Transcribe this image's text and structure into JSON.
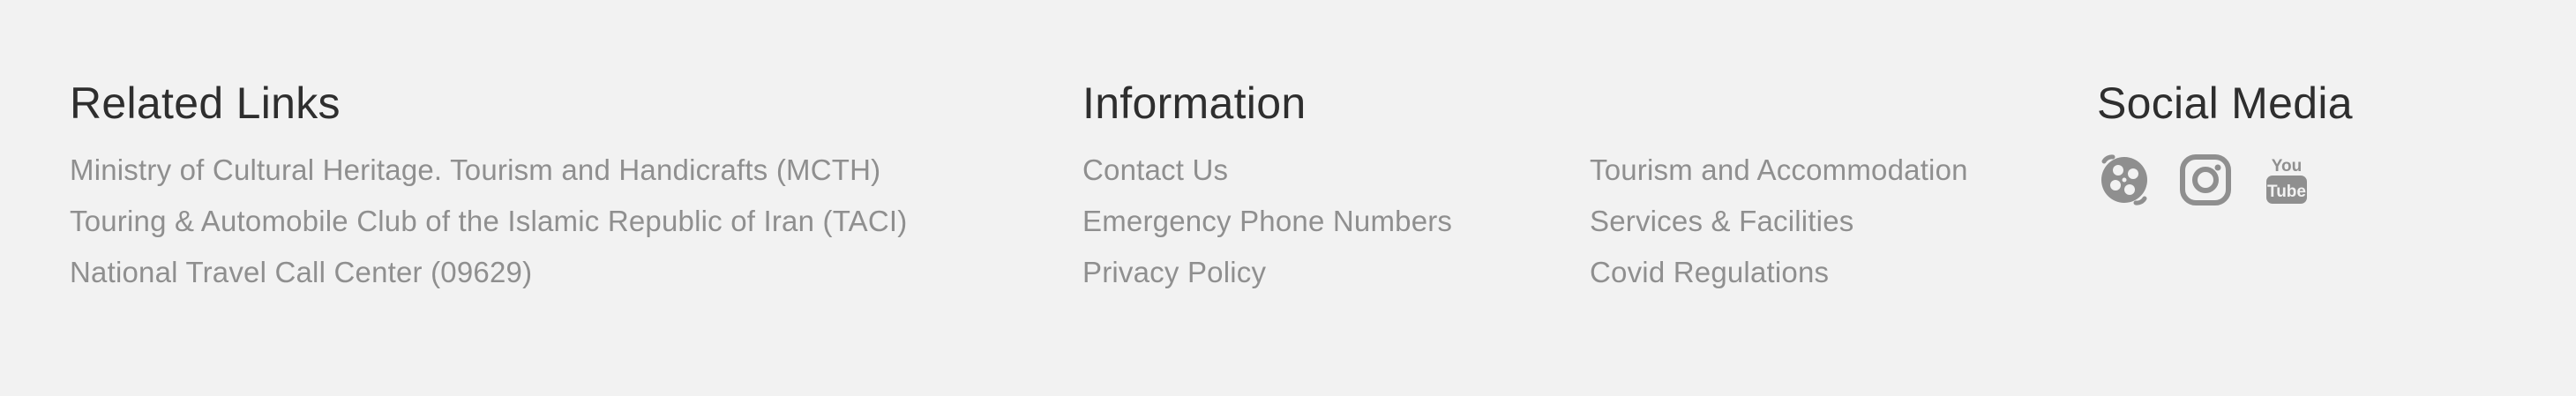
{
  "related": {
    "title": "Related Links",
    "links": [
      "Ministry of Cultural Heritage. Tourism and Handicrafts (MCTH)",
      "Touring & Automobile Club of the Islamic Republic of Iran (TACI)",
      "National Travel Call Center (09629)"
    ]
  },
  "information": {
    "title": "Information",
    "links_left": [
      "Contact Us",
      "Emergency Phone Numbers",
      "Privacy Policy"
    ],
    "links_right": [
      "Tourism and Accommodation",
      "Services & Facilities",
      "Covid Regulations"
    ]
  },
  "social": {
    "title": "Social Media",
    "icons": [
      "aparat-icon",
      "instagram-icon",
      "youtube-icon"
    ],
    "icon_color": "#8f8f8f"
  }
}
